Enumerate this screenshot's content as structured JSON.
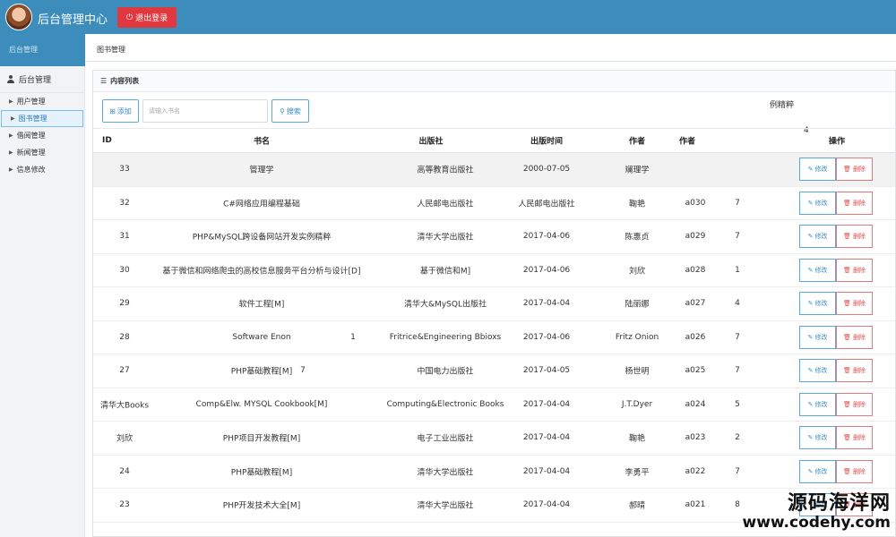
{
  "header": {
    "title": "后台管理中心",
    "logout_label": "退出登录"
  },
  "sidebar": {
    "strip_label": "后台管理",
    "title": "后台管理",
    "items": [
      {
        "label": "用户管理",
        "active": false
      },
      {
        "label": "图书管理",
        "active": true
      },
      {
        "label": "借阅管理",
        "active": false
      },
      {
        "label": "新闻管理",
        "active": false
      },
      {
        "label": "信息修改",
        "active": false
      }
    ]
  },
  "breadcrumb": "图书管理",
  "panel": {
    "title": "内容列表",
    "add_label": "添加",
    "search_placeholder": "请输入书名",
    "search_label": "搜索",
    "stray_text": "例精粹",
    "stray_mark": "4"
  },
  "table": {
    "headers": [
      "ID",
      "书名",
      "出版社",
      "出版时间",
      "作者",
      "作者",
      "操作"
    ],
    "edit_label": "修改",
    "delete_label": "删除",
    "rows": [
      {
        "id": "33",
        "name": "管理学",
        "publisher": "高等教育出版社",
        "date": "2000-07-05",
        "author": "斓理学",
        "code": "",
        "num": "",
        "extra": ""
      },
      {
        "id": "32",
        "name": "C#网络应用编程基础",
        "publisher": "人民邮电出版社",
        "date": "人民邮电出版社",
        "author": "鞠艳",
        "code": "a030",
        "num": "7",
        "extra": ""
      },
      {
        "id": "31",
        "name": "PHP&MySQL跨设备网站开发实例精粹",
        "publisher": "清华大学出版社",
        "date": "2017-04-06",
        "author": "陈惠贞",
        "code": "a029",
        "num": "7",
        "extra": ""
      },
      {
        "id": "30",
        "name": "基于微信和网络爬虫的高校信息服务平台分析与设计[D]",
        "publisher": "基于微信和M]",
        "date": "2017-04-06",
        "author": "刘欣",
        "code": "a028",
        "num": "1",
        "extra": ""
      },
      {
        "id": "29",
        "name": "软件工程[M]",
        "publisher": "清华大&MySQL出版社",
        "date": "2017-04-04",
        "author": "陆丽娜",
        "code": "a027",
        "num": "4",
        "extra": ""
      },
      {
        "id": "28",
        "name": "Software Enon",
        "publisher": "Fritrice&Engineering Bbioxs",
        "date": "2017-04-06",
        "author": "Fritz Onion",
        "code": "a026",
        "num": "7",
        "extra": "1"
      },
      {
        "id": "27",
        "name": "PHP基础教程[M]",
        "publisher": "中国电力出版社",
        "date": "2017-04-05",
        "author": "杨世明",
        "code": "a025",
        "num": "7",
        "extra": "7"
      },
      {
        "id": "清华大Books",
        "name": "Comp&Elw. MYSQL Cookbook[M]",
        "publisher": "Computing&Electronic Books",
        "date": "2017-04-04",
        "author": "J.T.Dyer",
        "code": "a024",
        "num": "5",
        "extra": ""
      },
      {
        "id": "刘欣",
        "name": "PHP项目开发教程[M]",
        "publisher": "电子工业出版社",
        "date": "2017-04-04",
        "author": "鞠艳",
        "code": "a023",
        "num": "2",
        "extra": ""
      },
      {
        "id": "24",
        "name": "PHP基础教程[M]",
        "publisher": "清华大学出版社",
        "date": "2017-04-04",
        "author": "李勇平",
        "code": "a022",
        "num": "7",
        "extra": ""
      },
      {
        "id": "23",
        "name": "PHP开发技术大全[M]",
        "publisher": "清华大学出版社",
        "date": "2017-04-04",
        "author": "郝晴",
        "code": "a021",
        "num": "8",
        "extra": ""
      }
    ]
  },
  "watermark": {
    "cn": "源码海洋网",
    "url": "www.codehy.com"
  }
}
